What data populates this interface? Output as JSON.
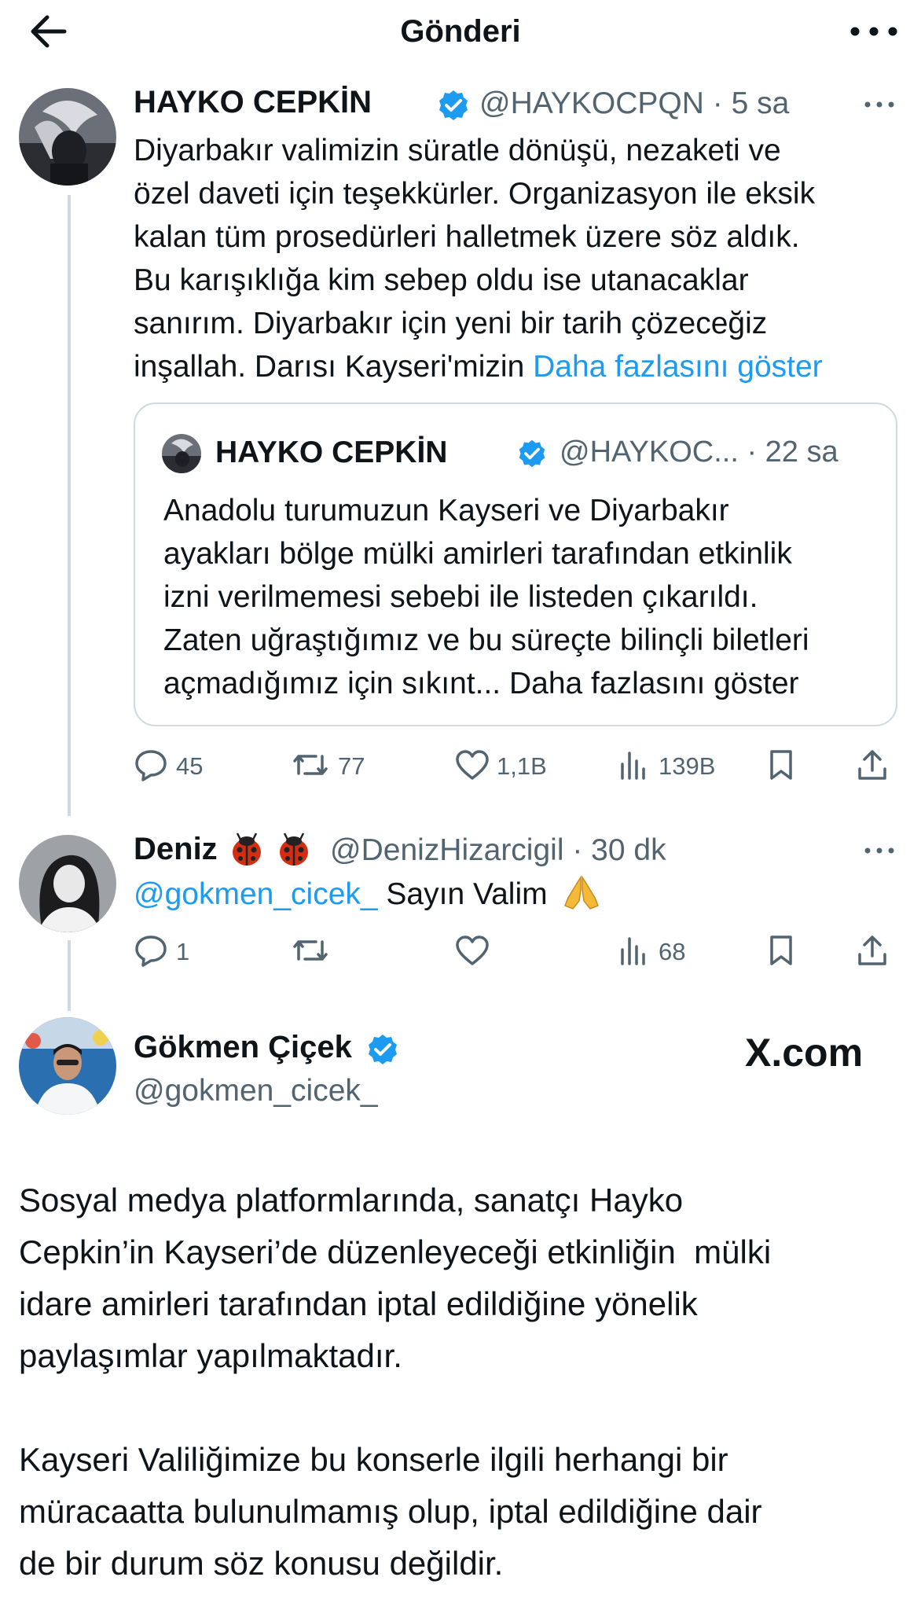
{
  "header": {
    "title": "Gönderi",
    "back_icon": "arrow-left-icon",
    "more_icon": "more-dots-icon"
  },
  "tweet1": {
    "name": "HAYKO CEPKİN",
    "handle": "@HAYKOCPQN",
    "time": "· 5 sa",
    "text_lines": [
      "Diyarbakır valimizin süratle dönüşü, nezaketi ve",
      "özel daveti için teşekkürler. Organizasyon ile eksik",
      "kalan tüm prosedürleri halletmek üzere söz aldık.",
      "Bu karışıklığa kim sebep oldu ise utanacaklar",
      "sanırım.  Diyarbakır için yeni bir tarih çözeceğiz",
      "inşallah. Darısı Kayseri'mizin "
    ],
    "show_more": "Daha fazlasını göster",
    "quote": {
      "name": "HAYKO CEPKİN",
      "handle": "@HAYKOC... · 22 sa",
      "text_lines": [
        "Anadolu turumuzun Kayseri ve Diyarbakır",
        "ayakları bölge mülki amirleri tarafından etkinlik",
        "izni verilmemesi sebebi ile listeden çıkarıldı.",
        "Zaten uğraştığımız ve bu süreçte bilinçli biletleri",
        "açmadığımız için sıkınt... Daha fazlasını göster"
      ]
    },
    "stats": {
      "replies": "45",
      "retweets": "77",
      "likes": "1,1B",
      "views": "139B"
    }
  },
  "tweet2": {
    "name": "Deniz",
    "emoji_icon": "ladybug-icon",
    "handle": "@DenizHizarcigil",
    "time": "· 30 dk",
    "mention": "@gokmen_cicek_",
    "text": " Sayın Valim",
    "emoji_end": "folded-hands-icon",
    "stats": {
      "replies": "1",
      "retweets": "",
      "likes": "",
      "views": "68"
    }
  },
  "tweet3": {
    "name": "Gökmen Çiçek",
    "handle": "@gokmen_cicek_",
    "brand": "X.com",
    "paragraph1_lines": [
      "Sosyal medya platformlarında, sanatçı Hayko",
      "Cepkin’in Kayseri’de düzenleyeceği etkinliğin  mülki",
      "idare amirleri tarafından iptal edildiğine yönelik",
      "paylaşımlar yapılmaktadır."
    ],
    "paragraph2_lines": [
      "Kayseri Valiliğimize bu konserle ilgili herhangi bir",
      "müracaatta bulunulmamış olup, iptal edildiğine dair",
      "de bir durum söz konusu değildir."
    ]
  },
  "colors": {
    "link": "#1d9bf0",
    "verified": "#1d9bf0",
    "muted": "#536471",
    "border": "#cfd9de"
  }
}
